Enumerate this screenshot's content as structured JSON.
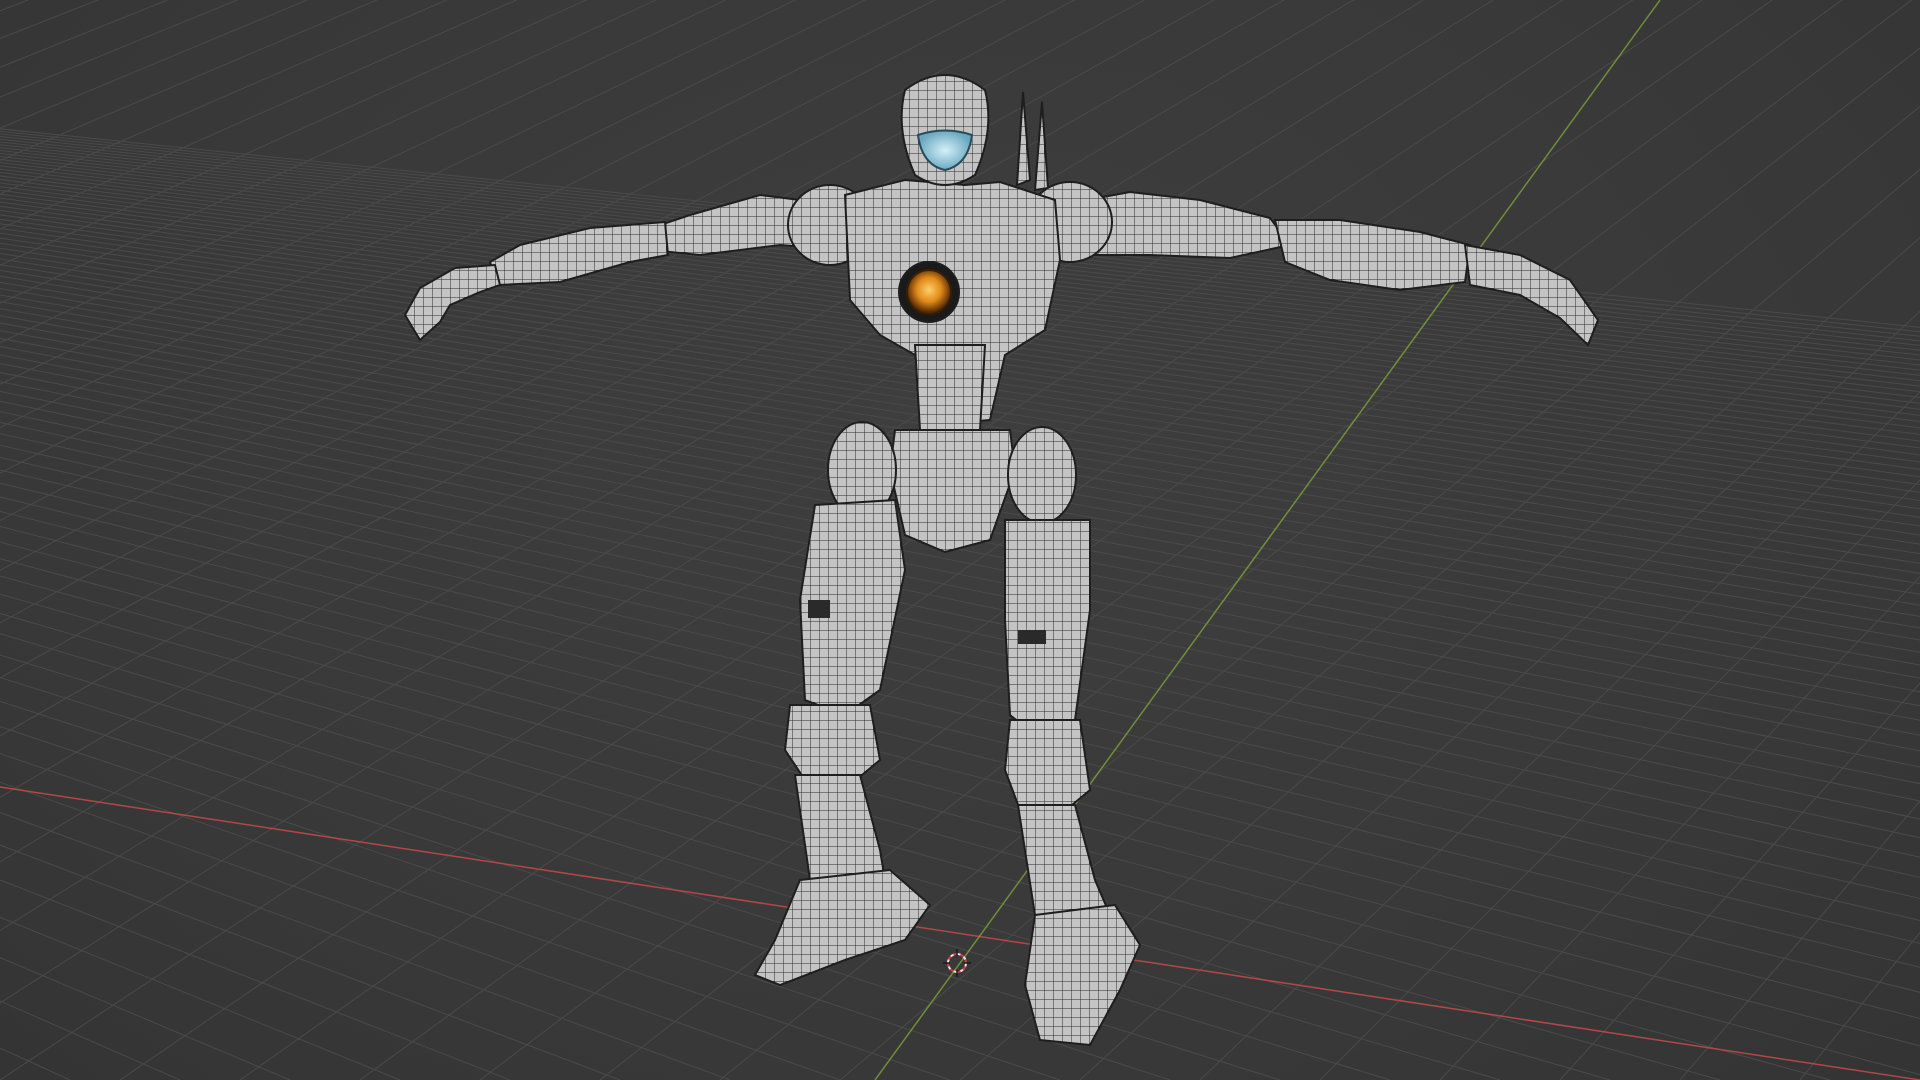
{
  "viewport": {
    "background_color": "#3a3a3a",
    "grid_line_color": "#4a4a4a",
    "axis_x_color": "#c94a4a",
    "axis_y_color": "#7fa33a",
    "cursor_color": "#e8e8e8",
    "cursor_accent": "#d04040"
  },
  "model": {
    "shading": "wireframe-over-solid",
    "body_color": "#bdbdbd",
    "wire_color": "#2a2a2a",
    "chest_core_color": "#e08a1a",
    "visor_color": "#8fc8dd"
  }
}
